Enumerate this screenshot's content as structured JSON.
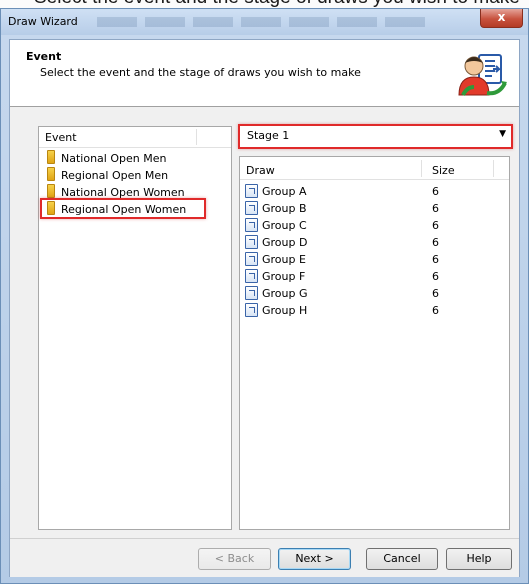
{
  "caption": "Select the event and the stage of draws you wish to make",
  "window": {
    "title": "Draw Wizard",
    "close_glyph": "x"
  },
  "header": {
    "title": "Event",
    "subtitle": "Select the event and the stage of draws you wish to make",
    "icon": "wizard-person-document-icon"
  },
  "event_list": {
    "column_header": "Event",
    "items": [
      {
        "label": "National Open Men",
        "icon": "event-icon"
      },
      {
        "label": "Regional Open Men",
        "icon": "event-icon"
      },
      {
        "label": "National Open Women",
        "icon": "event-icon"
      },
      {
        "label": "Regional Open Women",
        "icon": "event-icon",
        "selected": true
      }
    ]
  },
  "stage_select": {
    "value": "Stage 1"
  },
  "draw_list": {
    "columns": [
      "Draw",
      "Size"
    ],
    "rows": [
      {
        "draw": "Group A",
        "size": "6"
      },
      {
        "draw": "Group B",
        "size": "6"
      },
      {
        "draw": "Group C",
        "size": "6"
      },
      {
        "draw": "Group D",
        "size": "6"
      },
      {
        "draw": "Group E",
        "size": "6"
      },
      {
        "draw": "Group F",
        "size": "6"
      },
      {
        "draw": "Group G",
        "size": "6"
      },
      {
        "draw": "Group H",
        "size": "6"
      }
    ]
  },
  "buttons": {
    "back": "< Back",
    "next": "Next >",
    "cancel": "Cancel",
    "help": "Help"
  },
  "colors": {
    "highlight_outline": "#e02a2a",
    "titlebar": "#c7d9ee",
    "close_button": "#c8523e"
  }
}
